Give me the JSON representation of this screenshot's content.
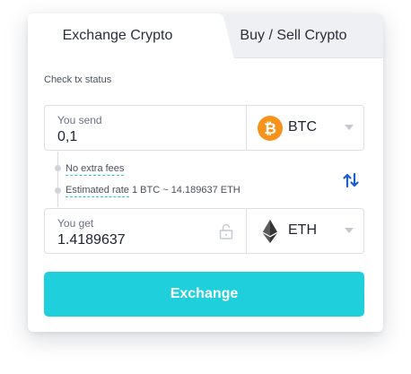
{
  "tabs": [
    {
      "label": "Exchange Crypto",
      "active": true
    },
    {
      "label": "Buy / Sell Crypto",
      "active": false
    }
  ],
  "check_status": "Check tx status",
  "send": {
    "label": "You send",
    "value": "0,1",
    "currency": {
      "ticker": "BTC",
      "icon": "bitcoin-icon",
      "color": "#f7931a"
    }
  },
  "info": {
    "fees": "No extra fees",
    "rate_label": "Estimated rate",
    "rate_value": "1 BTC ~ 14.189637 ETH"
  },
  "get": {
    "label": "You get",
    "value": "1.4189637",
    "currency": {
      "ticker": "ETH",
      "icon": "ethereum-icon",
      "color": "#343434"
    }
  },
  "exchange_button": "Exchange",
  "colors": {
    "accent": "#1fd0dc",
    "swap_icon": "#1a5fd0"
  }
}
